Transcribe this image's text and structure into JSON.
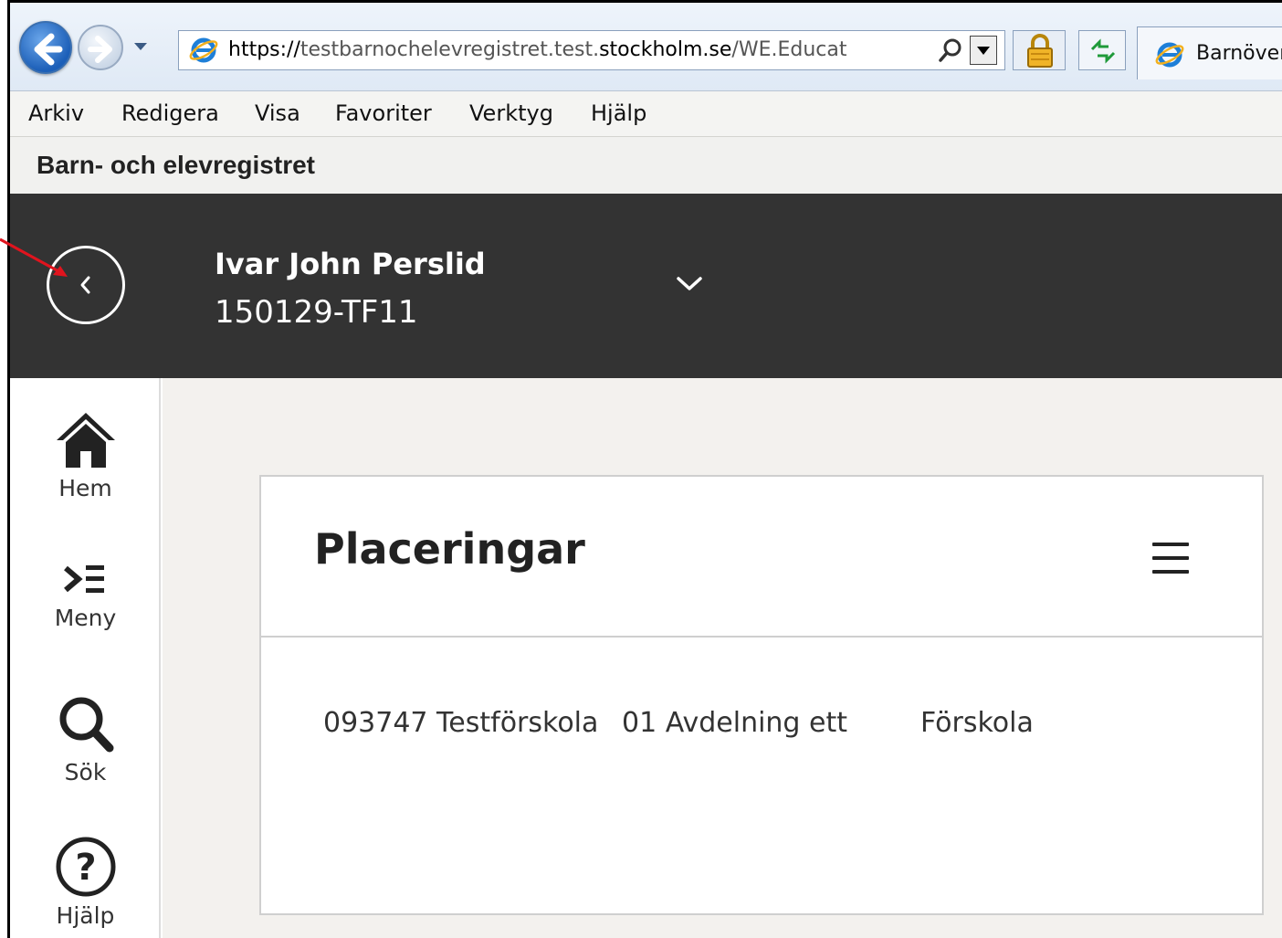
{
  "browser": {
    "url_prefix": "https://",
    "url_domain_pre": "testbarnochelevregistret.test.",
    "url_domain_main": "stockholm.se",
    "url_path": "/WE.Educat",
    "tab_title": "Barnöver"
  },
  "menubar": {
    "items": [
      "Arkiv",
      "Redigera",
      "Visa",
      "Favoriter",
      "Verktyg",
      "Hjälp"
    ]
  },
  "app": {
    "title": "Barn- och elevregistret"
  },
  "person": {
    "name": "Ivar John Perslid",
    "id": "150129-TF11"
  },
  "sidebar": {
    "items": [
      {
        "label": "Hem",
        "icon": "home-icon"
      },
      {
        "label": "Meny",
        "icon": "menu-icon"
      },
      {
        "label": "Sök",
        "icon": "search-icon"
      },
      {
        "label": "Hjälp",
        "icon": "help-icon"
      }
    ]
  },
  "placements": {
    "title": "Placeringar",
    "rows": [
      {
        "school": "093747 Testförskola",
        "unit": "01 Avdelning ett",
        "type": "Förskola"
      }
    ]
  },
  "colors": {
    "header_bg": "#333333",
    "content_bg": "#f3f1ee",
    "annotation_arrow": "#e0141e"
  }
}
